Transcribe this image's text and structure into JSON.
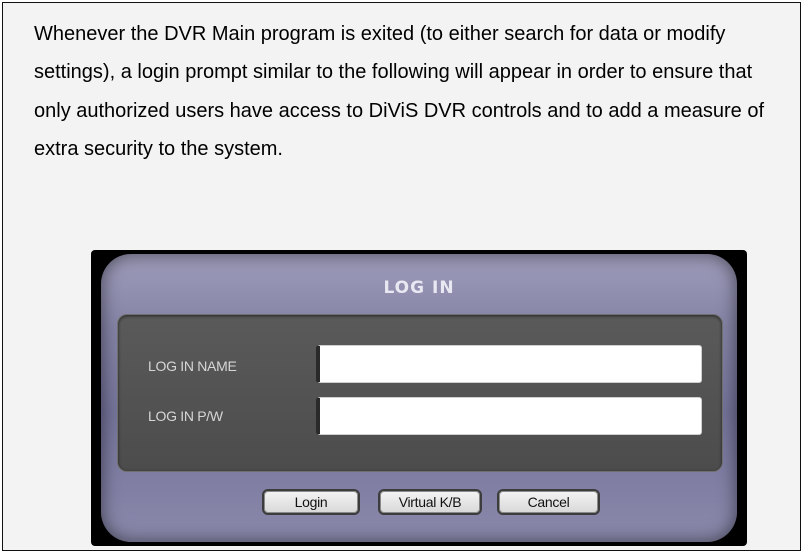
{
  "intro_text": "Whenever the DVR Main program is exited (to either search for data or modify settings), a login prompt similar to the following will appear in order to ensure that only authorized users have access to DiViS DVR controls and to add a measure of extra security to the system.",
  "dialog": {
    "title": "LOG IN",
    "name_label": "LOG IN NAME",
    "name_value": "",
    "password_label": "LOG IN P/W",
    "password_value": "",
    "buttons": {
      "login": "Login",
      "virtual_keyboard": "Virtual K/B",
      "cancel": "Cancel"
    }
  }
}
